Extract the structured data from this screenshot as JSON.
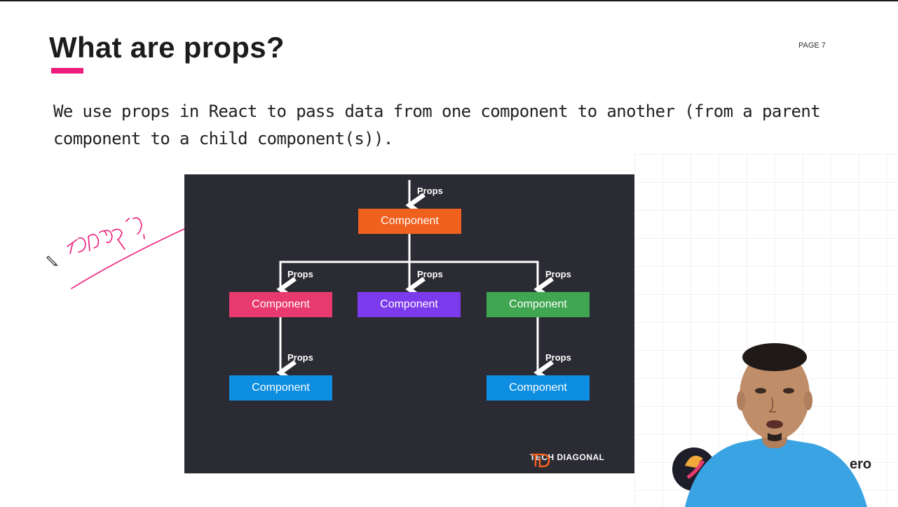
{
  "slide": {
    "title": "What are props?",
    "page_label": "PAGE 7",
    "description": "We use props in React to pass data from one component to another (from a parent component to a child component(s))."
  },
  "diagram": {
    "root": "Component",
    "children": [
      {
        "label": "Component",
        "color": "#e83a6e"
      },
      {
        "label": "Component",
        "color": "#7c3aed"
      },
      {
        "label": "Component",
        "color": "#41a651"
      }
    ],
    "grandchildren": [
      {
        "label": "Component",
        "color": "#0d8ee0"
      },
      {
        "label": "Component",
        "color": "#0d8ee0"
      }
    ],
    "root_color": "#f0601e",
    "props_label": "Props",
    "brand": "TECH DIAGONAL"
  },
  "overlay": {
    "channel_text": "ero",
    "cursor_icon": "pencil-cursor-icon"
  }
}
